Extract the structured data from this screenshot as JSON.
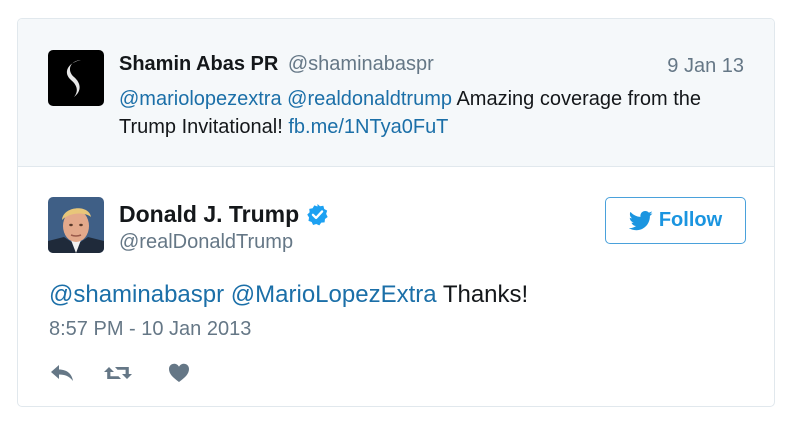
{
  "parent_tweet": {
    "author_name": "Shamin Abas PR",
    "author_handle": "@shaminabaspr",
    "date": "9 Jan 13",
    "mention_1": "@mariolopezextra",
    "mention_2": "@realdonaldtrump",
    "text_line_1": "Amazing coverage from the",
    "text_line_2": "Trump Invitational!",
    "link": "fb.me/1NTya0FuT",
    "avatar_icon": "stylized-s-logo-icon"
  },
  "tweet": {
    "author_name": "Donald J. Trump",
    "author_handle": "@realDonaldTrump",
    "verified_icon": "verified-badge-icon",
    "avatar_icon": "profile-photo",
    "mention_1": "@shaminabaspr",
    "mention_2": "@MarioLopezExtra",
    "text": "Thanks!",
    "timestamp": "8:57 PM - 10 Jan 2013"
  },
  "follow_button": {
    "label": "Follow",
    "icon": "twitter-bird-icon"
  },
  "actions": [
    {
      "name": "reply",
      "icon": "reply-icon"
    },
    {
      "name": "retweet",
      "icon": "retweet-icon"
    },
    {
      "name": "like",
      "icon": "heart-icon"
    }
  ],
  "colors": {
    "link": "#1b6fa8",
    "accent": "#1b95e0",
    "secondary_text": "#657786",
    "parent_background": "#f5f8fa",
    "border": "#e1e8ed"
  }
}
